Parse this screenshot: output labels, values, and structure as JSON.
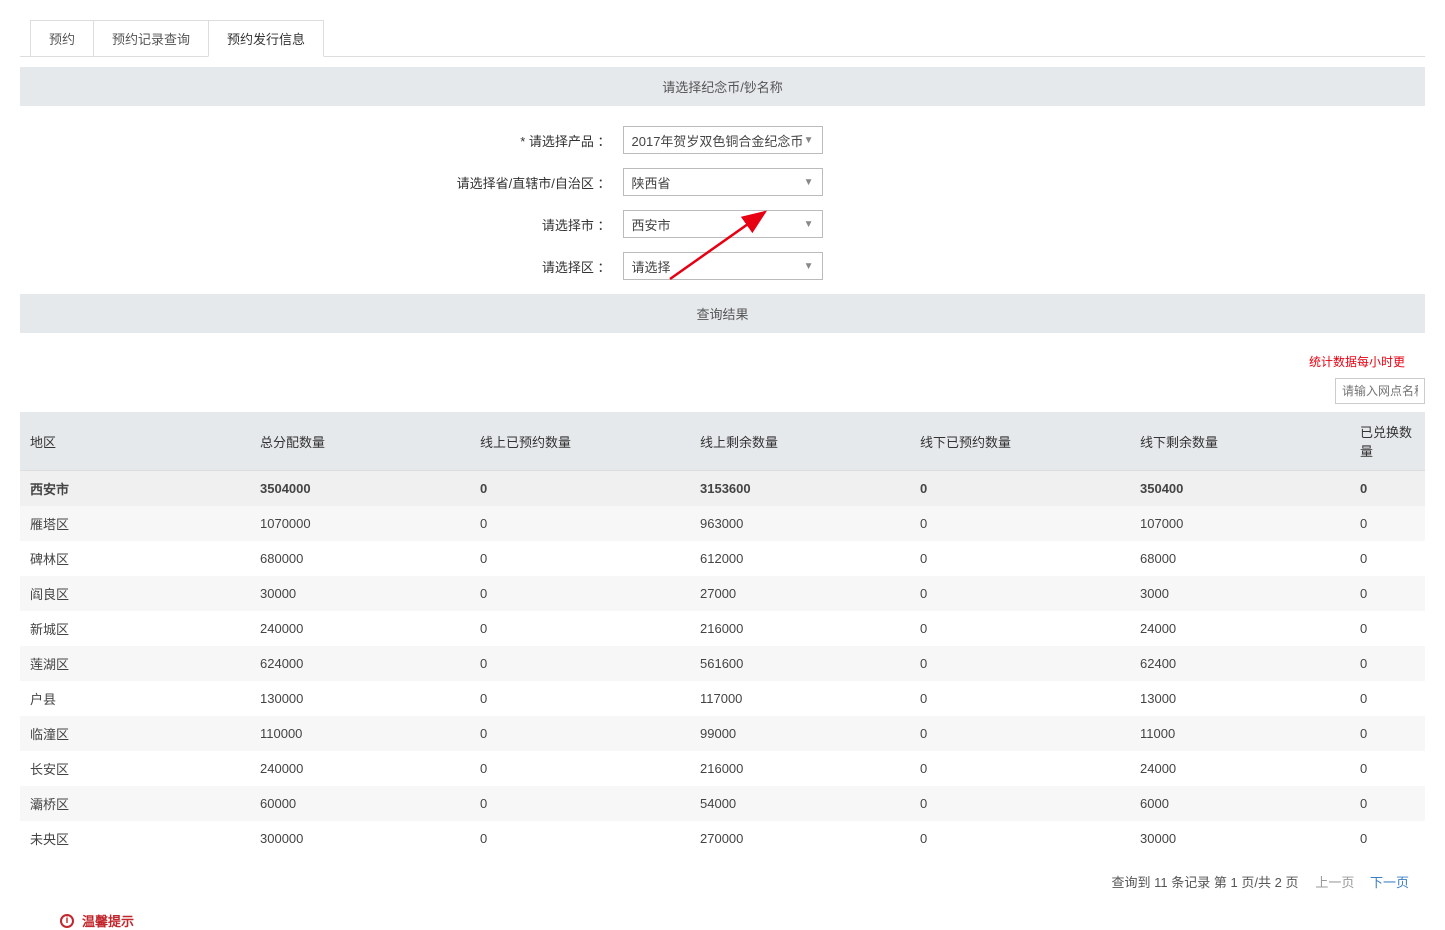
{
  "tabs": [
    {
      "label": "预约"
    },
    {
      "label": "预约记录查询"
    },
    {
      "label": "预约发行信息"
    }
  ],
  "section1_title": "请选择纪念币/钞名称",
  "form": {
    "product_label": "*  请选择产品   ：",
    "product_value": "2017年贺岁双色铜合金纪念币",
    "province_label": "请选择省/直辖市/自治区   ：",
    "province_value": "陕西省",
    "city_label": "请选择市   ：",
    "city_value": "西安市",
    "district_label": "请选择区   ：",
    "district_value": "请选择"
  },
  "section2_title": "查询结果",
  "notice_text": "统计数据每小时更",
  "search_placeholder": "请输入网点名称",
  "table": {
    "headers": [
      "地区",
      "总分配数量",
      "线上已预约数量",
      "线上剩余数量",
      "线下已预约数量",
      "线下剩余数量",
      "已兑换数量"
    ],
    "summary": {
      "region": "西安市",
      "total": "3504000",
      "online_booked": "0",
      "online_remain": "3153600",
      "offline_booked": "0",
      "offline_remain": "350400",
      "redeemed": "0"
    },
    "rows": [
      {
        "region": "雁塔区",
        "total": "1070000",
        "online_booked": "0",
        "online_remain": "963000",
        "offline_booked": "0",
        "offline_remain": "107000",
        "redeemed": "0"
      },
      {
        "region": "碑林区",
        "total": "680000",
        "online_booked": "0",
        "online_remain": "612000",
        "offline_booked": "0",
        "offline_remain": "68000",
        "redeemed": "0"
      },
      {
        "region": "阎良区",
        "total": "30000",
        "online_booked": "0",
        "online_remain": "27000",
        "offline_booked": "0",
        "offline_remain": "3000",
        "redeemed": "0"
      },
      {
        "region": "新城区",
        "total": "240000",
        "online_booked": "0",
        "online_remain": "216000",
        "offline_booked": "0",
        "offline_remain": "24000",
        "redeemed": "0"
      },
      {
        "region": "莲湖区",
        "total": "624000",
        "online_booked": "0",
        "online_remain": "561600",
        "offline_booked": "0",
        "offline_remain": "62400",
        "redeemed": "0"
      },
      {
        "region": "户县",
        "total": "130000",
        "online_booked": "0",
        "online_remain": "117000",
        "offline_booked": "0",
        "offline_remain": "13000",
        "redeemed": "0"
      },
      {
        "region": "临潼区",
        "total": "110000",
        "online_booked": "0",
        "online_remain": "99000",
        "offline_booked": "0",
        "offline_remain": "11000",
        "redeemed": "0"
      },
      {
        "region": "长安区",
        "total": "240000",
        "online_booked": "0",
        "online_remain": "216000",
        "offline_booked": "0",
        "offline_remain": "24000",
        "redeemed": "0"
      },
      {
        "region": "灞桥区",
        "total": "60000",
        "online_booked": "0",
        "online_remain": "54000",
        "offline_booked": "0",
        "offline_remain": "6000",
        "redeemed": "0"
      },
      {
        "region": "未央区",
        "total": "300000",
        "online_booked": "0",
        "online_remain": "270000",
        "offline_booked": "0",
        "offline_remain": "30000",
        "redeemed": "0"
      }
    ]
  },
  "pagination": {
    "info_prefix": "查询到",
    "count": "11",
    "info_mid": "条记录   第",
    "current": "1",
    "info_mid2": "页/共",
    "total_pages": "2",
    "info_suffix": "页",
    "prev": "上一页",
    "next": "下一页"
  },
  "tip_label": "温馨提示"
}
